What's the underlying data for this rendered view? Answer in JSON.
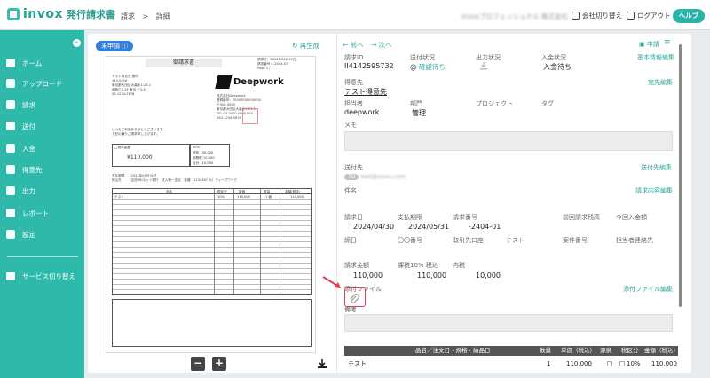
{
  "app": {
    "brand": "invox",
    "brand_sub": "発行請求書",
    "breadcrumb": [
      "請求",
      ">",
      "詳細"
    ],
    "company_name": "invoxプロフェッショナル 株式会社",
    "switch_company": "会社切り替え",
    "logout": "ログアウト",
    "help": "ヘルプ"
  },
  "sidebar": {
    "collapse": "«",
    "items": [
      {
        "label": "ホーム"
      },
      {
        "label": "アップロード"
      },
      {
        "label": "請求"
      },
      {
        "label": "送付"
      },
      {
        "label": "入金"
      },
      {
        "label": "得意先"
      },
      {
        "label": "出力"
      },
      {
        "label": "レポート"
      },
      {
        "label": "設定"
      }
    ],
    "service_switch": "サービス切り替え"
  },
  "preview": {
    "status_badge": "未申請 ⓘ",
    "regenerate": "再生成",
    "doc_title": "御請求書",
    "doc_meta": [
      "請求日：2024年04月30日",
      "請求番号：-2404-01",
      "Page 1 / 1"
    ],
    "doc_to": [
      "テスト得意先 御中",
      "143-0016",
      "東京都大田区大森北1-23-1",
      "昭和ビル2F 東京 ビル4F",
      "03-1234-5678"
    ],
    "dw_name": "Deepwork",
    "dw_info": [
      "株式会社Deepwork",
      "登録番号：T0000000000000",
      "〒000-0000",
      "東京都大田区大森北1-23-1",
      "TEL:03-0000-0000 FAX",
      "050-1234-5678"
    ],
    "note": [
      "いつもご利用ありがとうございます。",
      "下記の通りご請求申し上げます。"
    ],
    "sum_label": "ご請求金額",
    "sum_value": "¥110,000",
    "tax_rows": [
      "10%",
      "税抜 100,000",
      "消費税 10,000",
      "合計 110,000"
    ],
    "dates": [
      "支払期限　　2024年05月31日",
      "振込先　　　住信SBIネット銀行　法人第一支店　普通　1234567 カ）ディープワーク"
    ],
    "items_head": [
      "品名",
      "税区分",
      "単価",
      "数量",
      "金額(税抜)"
    ],
    "item_row": [
      "テスト",
      "10%",
      "110,000",
      "1 個",
      "110,000"
    ],
    "zoom_out": "−",
    "zoom_in": "+"
  },
  "detail": {
    "prev": "前へ",
    "next": "次へ",
    "apply": "申請",
    "menu": "≡",
    "id_label": "請求ID",
    "id_value": "II4142595732",
    "send_status_label": "送付状況",
    "send_status_value": "確認待ち",
    "output_status_label": "出力状況",
    "payment_status_label": "入金状況",
    "payment_status_value": "入金待ち",
    "basic_edit": "基本情報編集",
    "customer_label": "得意先",
    "customer_value": "テスト得意先",
    "address_edit": "宛先編集",
    "owner_label": "担当者",
    "owner_value": "deepwork",
    "dept_label": "部門",
    "dept_value": "管理",
    "project_label": "プロジェクト",
    "tag_label": "タグ",
    "memo_label": "メモ",
    "dest_label": "送付先",
    "dest_pill": "TO",
    "dest_value": "test@xxxx.com",
    "dest_edit": "送付先編集",
    "subject_label": "件名",
    "content_edit": "請求内容編集",
    "invoice_date_label": "請求日",
    "invoice_date_value": "2024/04/30",
    "due_label": "支払期限",
    "due_value": "2024/05/31",
    "number_label": "請求番号",
    "number_value": "-2404-01",
    "prev_balance_label": "前回請求残高",
    "this_amount_label": "今回入金額",
    "close_date_label": "締日",
    "oo_label": "〇〇番号",
    "bank_label": "取引先口座",
    "bank_value": "テスト",
    "case_label": "案件番号",
    "contact_label": "担当者連絡先",
    "amount_label": "請求金額",
    "amount_value": "110,000",
    "taxed_label": "課税10% 税込",
    "taxed_value": "110,000",
    "tax_label": "内税",
    "tax_value": "10,000",
    "attach_label": "添付ファイル",
    "attach_edit": "添付ファイル編集",
    "remarks_label": "備考",
    "table_head": [
      "品名／注文日・規格・納品日",
      "数量",
      "単価（税込）",
      "源泉",
      "税区分",
      "金額（税込）"
    ],
    "table_row": [
      "テスト",
      "1",
      "110,000",
      "",
      "10%",
      "110,000"
    ]
  },
  "colors": {
    "primary": "#2fb9aa",
    "link": "#2aa79b",
    "badge": "#2f7fd8",
    "highlight": "#e23b5a"
  }
}
